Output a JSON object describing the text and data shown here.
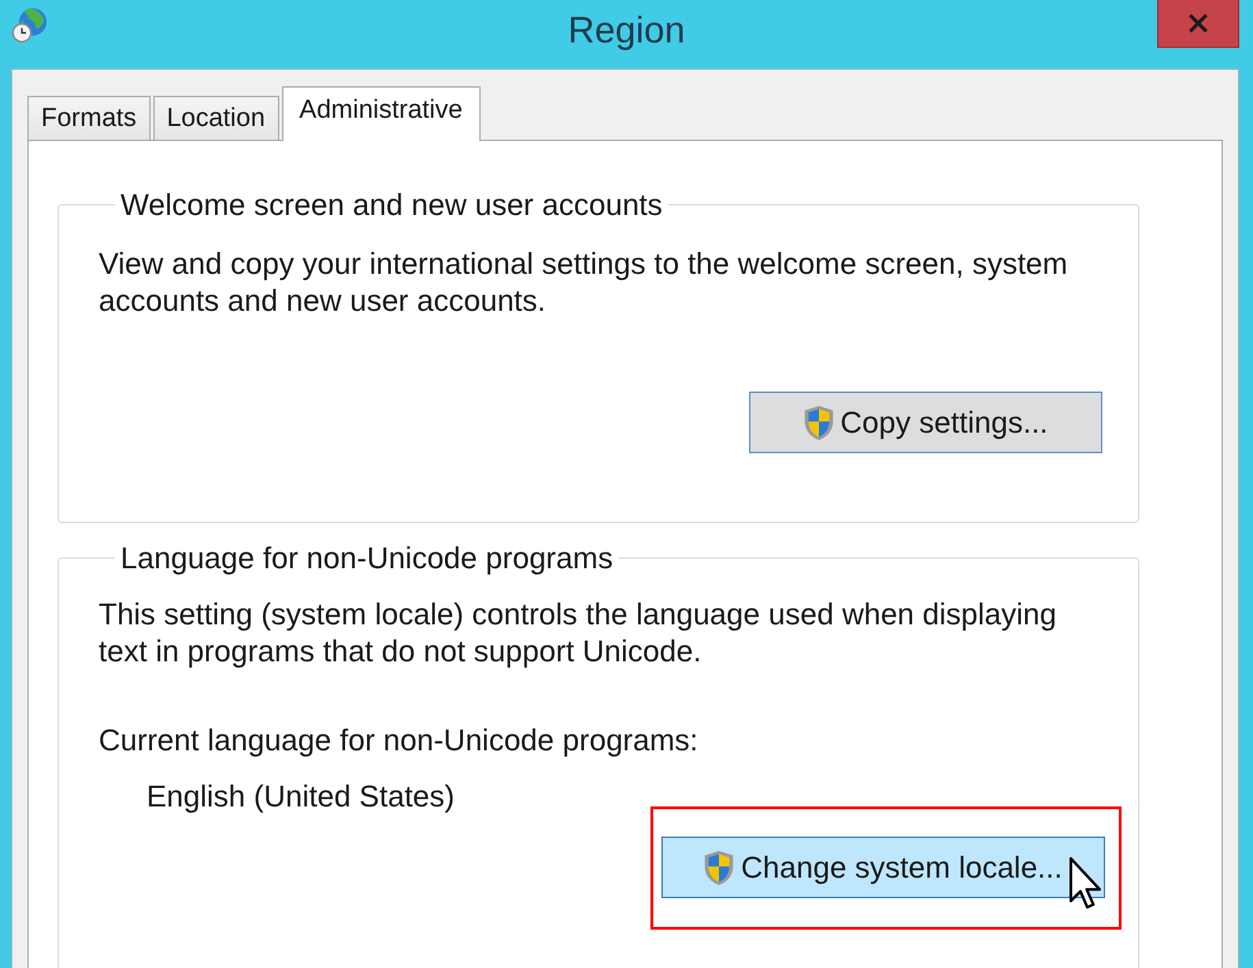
{
  "window": {
    "title": "Region"
  },
  "tabs": [
    {
      "label": "Formats",
      "selected": false
    },
    {
      "label": "Location",
      "selected": false
    },
    {
      "label": "Administrative",
      "selected": true
    }
  ],
  "groups": [
    {
      "title": "Welcome screen and new user accounts",
      "description": "View and copy your international settings to the welcome screen, system accounts and new user accounts.",
      "button": {
        "label": "Copy settings...",
        "hovered": false,
        "highlighted": false
      }
    },
    {
      "title": "Language for non-Unicode programs",
      "description": "This setting (system locale) controls the language used when displaying text in programs that do not support Unicode.",
      "current_label": "Current language for non-Unicode programs:",
      "current_value": "English (United States)",
      "button": {
        "label": "Change system locale...",
        "hovered": true,
        "highlighted": true
      }
    }
  ]
}
